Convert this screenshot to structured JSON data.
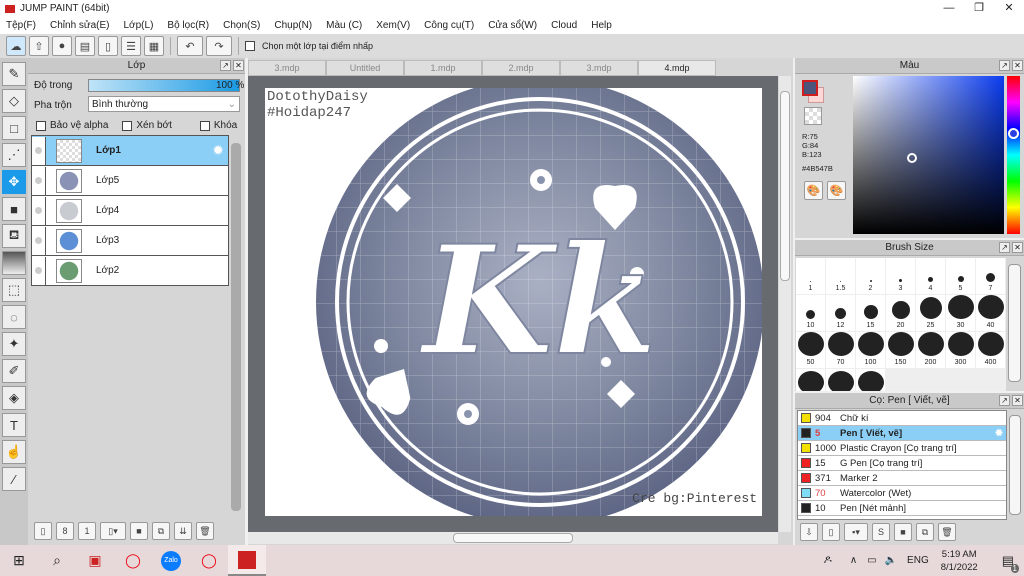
{
  "window": {
    "title": "JUMP PAINT (64bit)",
    "minimize": "—",
    "maximize": "❐",
    "close": "✕"
  },
  "menu": [
    "Tệp(F)",
    "Chỉnh sửa(E)",
    "Lớp(L)",
    "Bộ lọc(R)",
    "Chọn(S)",
    "Chụp(N)",
    "Màu (C)",
    "Xem(V)",
    "Công cụ(T)",
    "Cửa sổ(W)",
    "Cloud",
    "Help"
  ],
  "toolbar": {
    "select_layer_label": "Chọn một lớp tại điểm nhấp"
  },
  "layers_panel": {
    "title": "Lớp",
    "opacity_label": "Độ trong",
    "opacity_value": "100 %",
    "opacity_percent": 100,
    "blend_label": "Pha trộn",
    "blend_value": "Bình thường",
    "protect_alpha": "Bảo vệ alpha",
    "clipping": "Xén bớt",
    "lock": "Khóa",
    "layers": [
      {
        "name": "Lớp1",
        "selected": true
      },
      {
        "name": "Lớp5"
      },
      {
        "name": "Lớp4"
      },
      {
        "name": "Lớp3"
      },
      {
        "name": "Lớp2"
      }
    ]
  },
  "tabs": [
    "3.mdp",
    "Untitled",
    "1.mdp",
    "2.mdp",
    "3.mdp",
    "4.mdp"
  ],
  "active_tab": "4.mdp",
  "canvas": {
    "watermark_line1": "DotothyDaisy",
    "watermark_line2": "#Hoidap247",
    "logo_text": "Kk",
    "credit": "Cre bg:Pinterest"
  },
  "color_panel": {
    "title": "Màu",
    "r": "R:75",
    "g": "G:84",
    "b": "B:123",
    "hex": "#4B547B",
    "fg": "#4B547B",
    "bg": "#ffd6d6"
  },
  "brush_size_panel": {
    "title": "Brush Size",
    "sizes": [
      "1",
      "1.5",
      "2",
      "3",
      "4",
      "5",
      "7",
      "10",
      "12",
      "15",
      "20",
      "25",
      "30",
      "40",
      "50",
      "70",
      "100",
      "150",
      "200",
      "300",
      "400"
    ]
  },
  "brush_panel": {
    "title": "Cọ: Pen [ Viết, vẽ]",
    "brushes": [
      {
        "size": "904",
        "name": "Chữ kí",
        "color": "#f3e000"
      },
      {
        "size": "5",
        "name": "Pen [ Viết, vẽ]",
        "color": "#222222",
        "selected": true
      },
      {
        "size": "1000",
        "name": "Plastic Crayon [Cọ trang trí]",
        "color": "#f3e000"
      },
      {
        "size": "15",
        "name": "G Pen [Cọ trang trí]",
        "color": "#ee2222"
      },
      {
        "size": "371",
        "name": "Marker 2",
        "color": "#ee2222"
      },
      {
        "size": "70",
        "name": "Watercolor (Wet)",
        "color": "#7fdcf5"
      },
      {
        "size": "10",
        "name": "Pen [Nét mảnh]",
        "color": "#222222"
      }
    ]
  },
  "taskbar": {
    "lang": "ENG",
    "time": "5:19 AM",
    "date": "8/1/2022",
    "notifications": "1"
  }
}
